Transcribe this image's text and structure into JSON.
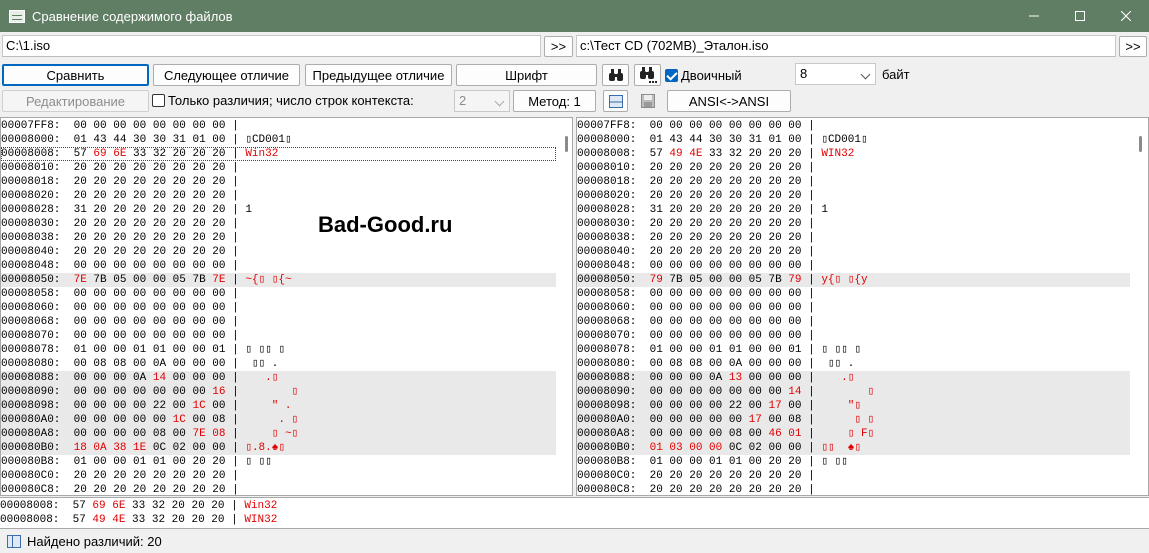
{
  "window": {
    "title": "Сравнение содержимого файлов"
  },
  "paths": {
    "left": "C:\\1.iso",
    "right": "c:\\Тест CD (702MB)_Эталон.iso",
    "browse_label": ">>"
  },
  "toolbar": {
    "compare": "Сравнить",
    "next_diff": "Следующее отличие",
    "prev_diff": "Предыдущее отличие",
    "font": "Шрифт",
    "binary_label": "Двоичный",
    "binary_checked": true,
    "bytes_value": "8",
    "bytes_unit": "байт",
    "edit": "Редактирование",
    "only_diff_label": "Только различия; число строк контекста:",
    "only_diff_checked": false,
    "context_value": "2",
    "method": "Метод: 1",
    "encoding": "ANSI<->ANSI"
  },
  "watermark": "Bad-Good.ru",
  "left_pane": [
    {
      "addr": "00007FF8:",
      "bytes": [
        "00",
        "00",
        "00",
        "00",
        "00",
        "00",
        "00",
        "00"
      ],
      "text": "",
      "diff": []
    },
    {
      "addr": "00008000:",
      "bytes": [
        "01",
        "43",
        "44",
        "30",
        "30",
        "31",
        "01",
        "00"
      ],
      "text": "▯CD001▯",
      "diff": []
    },
    {
      "addr": "00008008:",
      "bytes": [
        "57",
        "69",
        "6E",
        "33",
        "32",
        "20",
        "20",
        "20"
      ],
      "text": "Win32",
      "diff": [
        1,
        2
      ],
      "current": true
    },
    {
      "addr": "00008010:",
      "bytes": [
        "20",
        "20",
        "20",
        "20",
        "20",
        "20",
        "20",
        "20"
      ],
      "text": "",
      "diff": []
    },
    {
      "addr": "00008018:",
      "bytes": [
        "20",
        "20",
        "20",
        "20",
        "20",
        "20",
        "20",
        "20"
      ],
      "text": "",
      "diff": []
    },
    {
      "addr": "00008020:",
      "bytes": [
        "20",
        "20",
        "20",
        "20",
        "20",
        "20",
        "20",
        "20"
      ],
      "text": "",
      "diff": []
    },
    {
      "addr": "00008028:",
      "bytes": [
        "31",
        "20",
        "20",
        "20",
        "20",
        "20",
        "20",
        "20"
      ],
      "text": "1",
      "diff": []
    },
    {
      "addr": "00008030:",
      "bytes": [
        "20",
        "20",
        "20",
        "20",
        "20",
        "20",
        "20",
        "20"
      ],
      "text": "",
      "diff": []
    },
    {
      "addr": "00008038:",
      "bytes": [
        "20",
        "20",
        "20",
        "20",
        "20",
        "20",
        "20",
        "20"
      ],
      "text": "",
      "diff": []
    },
    {
      "addr": "00008040:",
      "bytes": [
        "20",
        "20",
        "20",
        "20",
        "20",
        "20",
        "20",
        "20"
      ],
      "text": "",
      "diff": []
    },
    {
      "addr": "00008048:",
      "bytes": [
        "00",
        "00",
        "00",
        "00",
        "00",
        "00",
        "00",
        "00"
      ],
      "text": "",
      "diff": []
    },
    {
      "addr": "00008050:",
      "bytes": [
        "7E",
        "7B",
        "05",
        "00",
        "00",
        "05",
        "7B",
        "7E"
      ],
      "text": "~{▯ ▯{~",
      "diff": [
        0,
        7
      ],
      "row_diff": true
    },
    {
      "addr": "00008058:",
      "bytes": [
        "00",
        "00",
        "00",
        "00",
        "00",
        "00",
        "00",
        "00"
      ],
      "text": "",
      "diff": []
    },
    {
      "addr": "00008060:",
      "bytes": [
        "00",
        "00",
        "00",
        "00",
        "00",
        "00",
        "00",
        "00"
      ],
      "text": "",
      "diff": []
    },
    {
      "addr": "00008068:",
      "bytes": [
        "00",
        "00",
        "00",
        "00",
        "00",
        "00",
        "00",
        "00"
      ],
      "text": "",
      "diff": []
    },
    {
      "addr": "00008070:",
      "bytes": [
        "00",
        "00",
        "00",
        "00",
        "00",
        "00",
        "00",
        "00"
      ],
      "text": "",
      "diff": []
    },
    {
      "addr": "00008078:",
      "bytes": [
        "01",
        "00",
        "00",
        "01",
        "01",
        "00",
        "00",
        "01"
      ],
      "text": "▯ ▯▯ ▯",
      "diff": []
    },
    {
      "addr": "00008080:",
      "bytes": [
        "00",
        "08",
        "08",
        "00",
        "0A",
        "00",
        "00",
        "00"
      ],
      "text": " ▯▯ .",
      "diff": []
    },
    {
      "addr": "00008088:",
      "bytes": [
        "00",
        "00",
        "00",
        "0A",
        "14",
        "00",
        "00",
        "00"
      ],
      "text": "   .▯",
      "diff": [
        4
      ],
      "row_diff": true
    },
    {
      "addr": "00008090:",
      "bytes": [
        "00",
        "00",
        "00",
        "00",
        "00",
        "00",
        "00",
        "16"
      ],
      "text": "       ▯",
      "diff": [
        7
      ],
      "row_diff": true
    },
    {
      "addr": "00008098:",
      "bytes": [
        "00",
        "00",
        "00",
        "00",
        "22",
        "00",
        "1C",
        "00"
      ],
      "text": "    \" .",
      "diff": [
        6
      ],
      "row_diff": true
    },
    {
      "addr": "000080A0:",
      "bytes": [
        "00",
        "00",
        "00",
        "00",
        "00",
        "1C",
        "00",
        "08"
      ],
      "text": "     . ▯",
      "diff": [
        5
      ],
      "row_diff": true
    },
    {
      "addr": "000080A8:",
      "bytes": [
        "00",
        "00",
        "00",
        "00",
        "08",
        "00",
        "7E",
        "08"
      ],
      "text": "    ▯ ~▯",
      "diff": [
        6,
        7
      ],
      "row_diff": true
    },
    {
      "addr": "000080B0:",
      "bytes": [
        "18",
        "0A",
        "38",
        "1E",
        "0C",
        "02",
        "00",
        "00"
      ],
      "text": "▯.8.♠▯",
      "diff": [
        0,
        1,
        2,
        3
      ],
      "row_diff": true
    },
    {
      "addr": "000080B8:",
      "bytes": [
        "01",
        "00",
        "00",
        "01",
        "01",
        "00",
        "20",
        "20"
      ],
      "text": "▯ ▯▯",
      "diff": []
    },
    {
      "addr": "000080C0:",
      "bytes": [
        "20",
        "20",
        "20",
        "20",
        "20",
        "20",
        "20",
        "20"
      ],
      "text": "",
      "diff": []
    },
    {
      "addr": "000080C8:",
      "bytes": [
        "20",
        "20",
        "20",
        "20",
        "20",
        "20",
        "20",
        "20"
      ],
      "text": "",
      "diff": []
    }
  ],
  "right_pane": [
    {
      "addr": "00007FF8:",
      "bytes": [
        "00",
        "00",
        "00",
        "00",
        "00",
        "00",
        "00",
        "00"
      ],
      "text": "",
      "diff": []
    },
    {
      "addr": "00008000:",
      "bytes": [
        "01",
        "43",
        "44",
        "30",
        "30",
        "31",
        "01",
        "00"
      ],
      "text": "▯CD001▯",
      "diff": []
    },
    {
      "addr": "00008008:",
      "bytes": [
        "57",
        "49",
        "4E",
        "33",
        "32",
        "20",
        "20",
        "20"
      ],
      "text": "WIN32",
      "diff": [
        1,
        2
      ]
    },
    {
      "addr": "00008010:",
      "bytes": [
        "20",
        "20",
        "20",
        "20",
        "20",
        "20",
        "20",
        "20"
      ],
      "text": "",
      "diff": []
    },
    {
      "addr": "00008018:",
      "bytes": [
        "20",
        "20",
        "20",
        "20",
        "20",
        "20",
        "20",
        "20"
      ],
      "text": "",
      "diff": []
    },
    {
      "addr": "00008020:",
      "bytes": [
        "20",
        "20",
        "20",
        "20",
        "20",
        "20",
        "20",
        "20"
      ],
      "text": "",
      "diff": []
    },
    {
      "addr": "00008028:",
      "bytes": [
        "31",
        "20",
        "20",
        "20",
        "20",
        "20",
        "20",
        "20"
      ],
      "text": "1",
      "diff": []
    },
    {
      "addr": "00008030:",
      "bytes": [
        "20",
        "20",
        "20",
        "20",
        "20",
        "20",
        "20",
        "20"
      ],
      "text": "",
      "diff": []
    },
    {
      "addr": "00008038:",
      "bytes": [
        "20",
        "20",
        "20",
        "20",
        "20",
        "20",
        "20",
        "20"
      ],
      "text": "",
      "diff": []
    },
    {
      "addr": "00008040:",
      "bytes": [
        "20",
        "20",
        "20",
        "20",
        "20",
        "20",
        "20",
        "20"
      ],
      "text": "",
      "diff": []
    },
    {
      "addr": "00008048:",
      "bytes": [
        "00",
        "00",
        "00",
        "00",
        "00",
        "00",
        "00",
        "00"
      ],
      "text": "",
      "diff": []
    },
    {
      "addr": "00008050:",
      "bytes": [
        "79",
        "7B",
        "05",
        "00",
        "00",
        "05",
        "7B",
        "79"
      ],
      "text": "y{▯ ▯{y",
      "diff": [
        0,
        7
      ],
      "row_diff": true
    },
    {
      "addr": "00008058:",
      "bytes": [
        "00",
        "00",
        "00",
        "00",
        "00",
        "00",
        "00",
        "00"
      ],
      "text": "",
      "diff": []
    },
    {
      "addr": "00008060:",
      "bytes": [
        "00",
        "00",
        "00",
        "00",
        "00",
        "00",
        "00",
        "00"
      ],
      "text": "",
      "diff": []
    },
    {
      "addr": "00008068:",
      "bytes": [
        "00",
        "00",
        "00",
        "00",
        "00",
        "00",
        "00",
        "00"
      ],
      "text": "",
      "diff": []
    },
    {
      "addr": "00008070:",
      "bytes": [
        "00",
        "00",
        "00",
        "00",
        "00",
        "00",
        "00",
        "00"
      ],
      "text": "",
      "diff": []
    },
    {
      "addr": "00008078:",
      "bytes": [
        "01",
        "00",
        "00",
        "01",
        "01",
        "00",
        "00",
        "01"
      ],
      "text": "▯ ▯▯ ▯",
      "diff": []
    },
    {
      "addr": "00008080:",
      "bytes": [
        "00",
        "08",
        "08",
        "00",
        "0A",
        "00",
        "00",
        "00"
      ],
      "text": " ▯▯ .",
      "diff": []
    },
    {
      "addr": "00008088:",
      "bytes": [
        "00",
        "00",
        "00",
        "0A",
        "13",
        "00",
        "00",
        "00"
      ],
      "text": "   .▯",
      "diff": [
        4
      ],
      "row_diff": true
    },
    {
      "addr": "00008090:",
      "bytes": [
        "00",
        "00",
        "00",
        "00",
        "00",
        "00",
        "00",
        "14"
      ],
      "text": "       ▯",
      "diff": [
        7
      ],
      "row_diff": true
    },
    {
      "addr": "00008098:",
      "bytes": [
        "00",
        "00",
        "00",
        "00",
        "22",
        "00",
        "17",
        "00"
      ],
      "text": "    \"▯",
      "diff": [
        6
      ],
      "row_diff": true
    },
    {
      "addr": "000080A0:",
      "bytes": [
        "00",
        "00",
        "00",
        "00",
        "00",
        "17",
        "00",
        "08"
      ],
      "text": "     ▯ ▯",
      "diff": [
        5
      ],
      "row_diff": true
    },
    {
      "addr": "000080A8:",
      "bytes": [
        "00",
        "00",
        "00",
        "00",
        "08",
        "00",
        "46",
        "01"
      ],
      "text": "    ▯ F▯",
      "diff": [
        6,
        7
      ],
      "row_diff": true
    },
    {
      "addr": "000080B0:",
      "bytes": [
        "01",
        "03",
        "00",
        "00",
        "0C",
        "02",
        "00",
        "00"
      ],
      "text": "▯▯  ♠▯",
      "diff": [
        0,
        1,
        2,
        3
      ],
      "row_diff": true
    },
    {
      "addr": "000080B8:",
      "bytes": [
        "01",
        "00",
        "00",
        "01",
        "01",
        "00",
        "20",
        "20"
      ],
      "text": "▯ ▯▯",
      "diff": []
    },
    {
      "addr": "000080C0:",
      "bytes": [
        "20",
        "20",
        "20",
        "20",
        "20",
        "20",
        "20",
        "20"
      ],
      "text": "",
      "diff": []
    },
    {
      "addr": "000080C8:",
      "bytes": [
        "20",
        "20",
        "20",
        "20",
        "20",
        "20",
        "20",
        "20"
      ],
      "text": "",
      "diff": []
    }
  ],
  "compare_rows": [
    {
      "addr": "00008008:",
      "bytes": [
        "57",
        "69",
        "6E",
        "33",
        "32",
        "20",
        "20",
        "20"
      ],
      "text": "Win32",
      "diff": [
        1,
        2
      ]
    },
    {
      "addr": "00008008:",
      "bytes": [
        "57",
        "49",
        "4E",
        "33",
        "32",
        "20",
        "20",
        "20"
      ],
      "text": "WIN32",
      "diff": [
        1,
        2
      ]
    }
  ],
  "status": {
    "text": "Найдено различий: 20"
  },
  "colors": {
    "titlebar": "#5f7e64",
    "diff_text": "#e00000",
    "diff_row_bg": "#e9e9e9",
    "accent": "#0067c0"
  }
}
